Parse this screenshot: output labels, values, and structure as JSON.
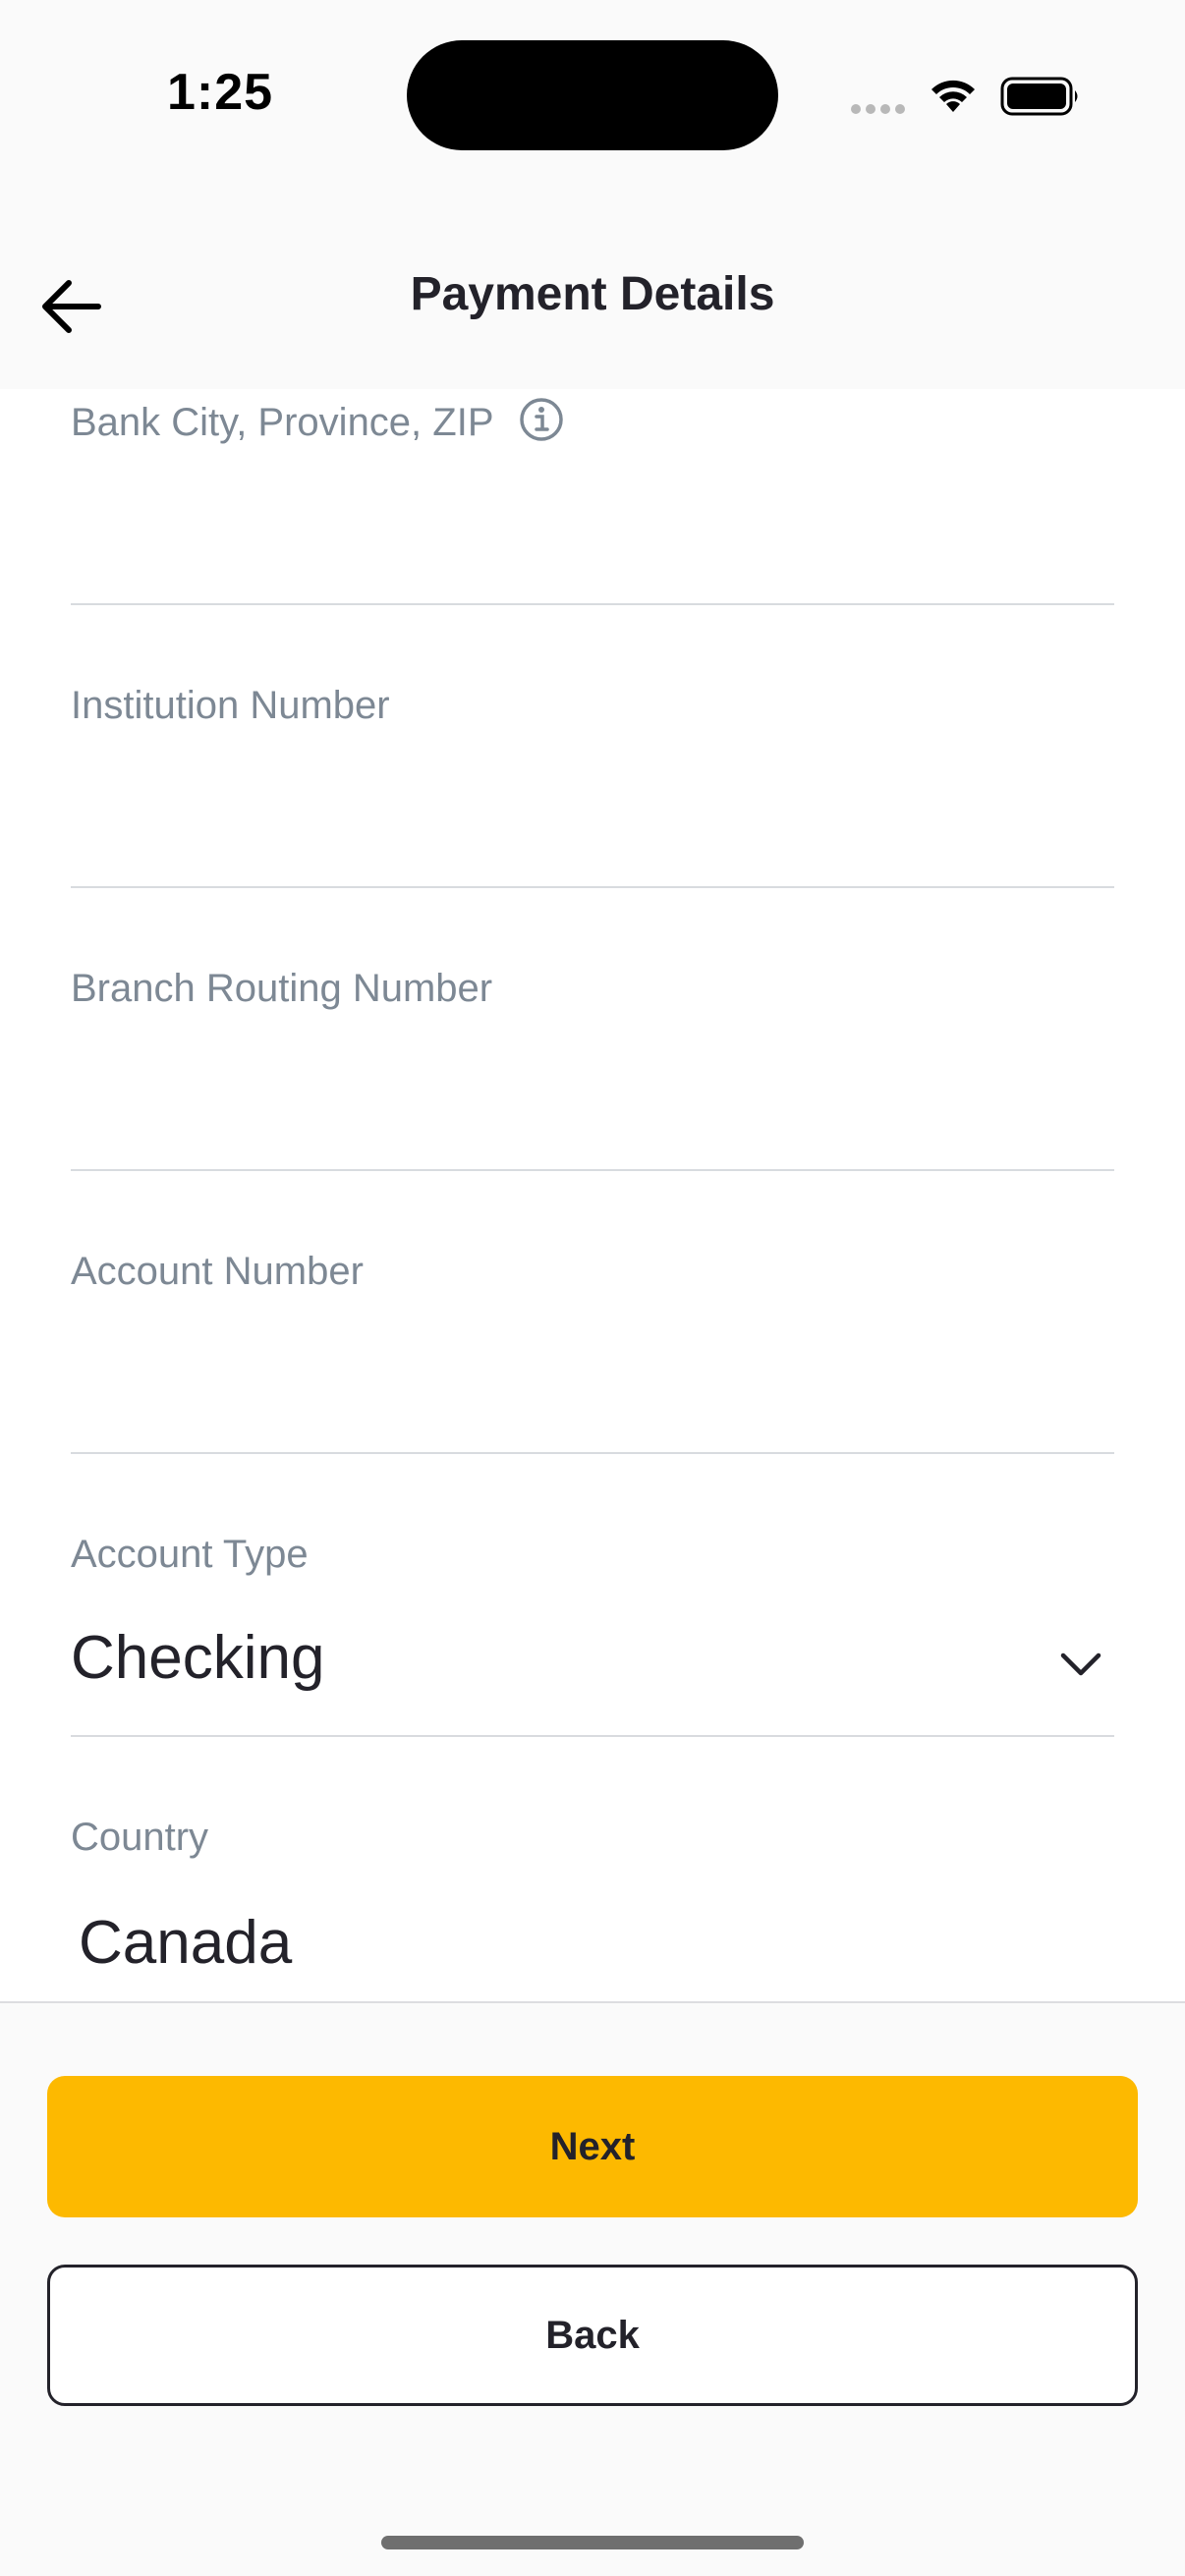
{
  "status_bar": {
    "time": "1:25"
  },
  "header": {
    "title": "Payment Details"
  },
  "form": {
    "bank_city": {
      "label": "Bank City, Province, ZIP",
      "value": ""
    },
    "institution_number": {
      "label": "Institution Number",
      "value": ""
    },
    "branch_routing_number": {
      "label": "Branch Routing Number",
      "value": ""
    },
    "account_number": {
      "label": "Account Number",
      "value": ""
    },
    "account_type": {
      "label": "Account Type",
      "value": "Checking"
    },
    "country": {
      "label": "Country",
      "value": "Canada"
    }
  },
  "actions": {
    "next_label": "Next",
    "back_label": "Back"
  },
  "colors": {
    "primary": "#fdb900",
    "text": "#23222a",
    "label": "#7d8894",
    "divider": "#d8dbdf"
  },
  "icons": {
    "back": "arrow-left-icon",
    "info": "info-icon",
    "dropdown": "chevron-down-icon"
  }
}
